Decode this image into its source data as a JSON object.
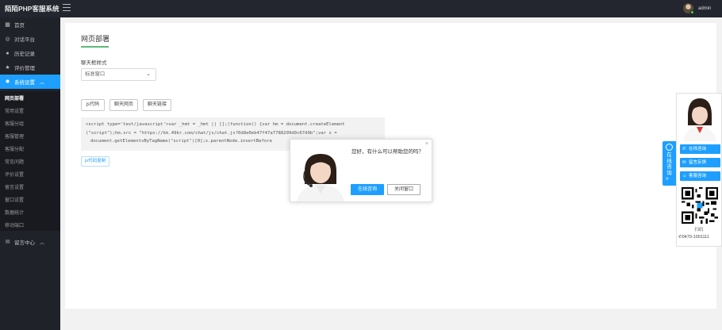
{
  "app": {
    "brand": "陌陌PHP客服系统",
    "admin_name": "admin"
  },
  "sidebar": {
    "items": [
      {
        "icon": "dashboard-icon",
        "label": "首页"
      },
      {
        "icon": "chat-icon",
        "label": "对话平台"
      },
      {
        "icon": "history-icon",
        "label": "历史记录"
      },
      {
        "icon": "star-icon",
        "label": "评价管理"
      },
      {
        "icon": "gear-icon",
        "label": "系统设置",
        "active": true
      }
    ],
    "sub_items": [
      "网页部署",
      "常用设置",
      "客服分组",
      "客服管理",
      "客服分配",
      "常见问题",
      "评价设置",
      "留言设置",
      "窗口设置",
      "数据统计",
      "移动端口"
    ],
    "bottom_item": {
      "icon": "message-icon",
      "label": "留言中心"
    }
  },
  "main": {
    "title": "网页部署",
    "style_label": "聊天框样式",
    "style_select": "标准窗口",
    "buttons": [
      "js代码",
      "聊天网页",
      "聊天链接"
    ],
    "code_lines": [
      "<script type='text/javascript'>var _hmt = _hmt || [];(function() {var hm = document.createElement",
      "(\"script\");hm.src = \"https://kk.49kr.com/chat/js/chat.js?0d8e0eb47f47a7788299d9c67d9b\";var s =",
      "document.getElementsByTagName(\"script\")[0];s.parentNode.insertBefore"
    ],
    "copy_button": "js代码复制"
  },
  "invite": {
    "message": "您好，有什么可以帮助您的吗？",
    "accept": "在线咨询",
    "decline": "关闭窗口",
    "close": "×"
  },
  "service_panel": {
    "tab_label": "在线咨询",
    "buttons": [
      {
        "icon": "chat-bubble-icon",
        "label": "在线咨询"
      },
      {
        "icon": "message-icon",
        "label": "留言反馈"
      },
      {
        "icon": "user-icon",
        "label": "客服咨询"
      }
    ],
    "qr_label": "扫码",
    "phone": "0470-1001111"
  },
  "colors": {
    "accent": "#1e9fff",
    "sidebar_bg": "#20222a",
    "topbar_bg": "#23262e",
    "underline": "#5fb878"
  }
}
